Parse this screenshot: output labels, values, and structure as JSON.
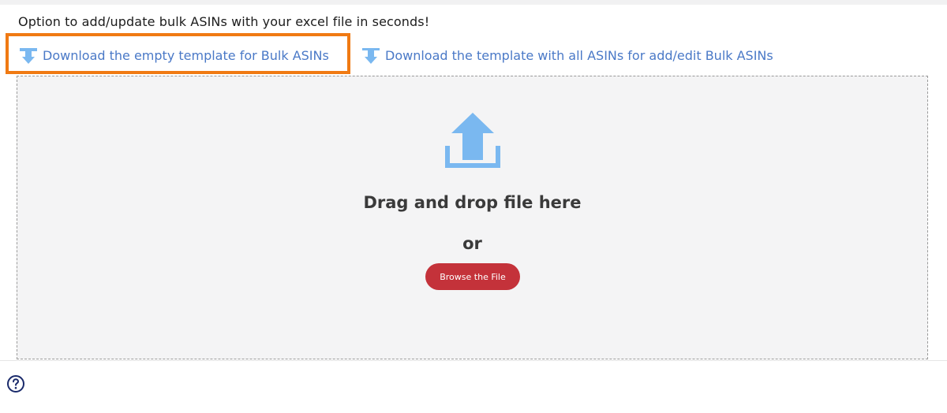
{
  "intro_text": "Option to add/update bulk ASINs with your excel file in seconds!",
  "links": {
    "empty_template": {
      "label": "Download the empty template for Bulk ASINs",
      "icon": "download-icon"
    },
    "all_asins_template": {
      "label": "Download the template with all ASINs for add/edit Bulk ASINs",
      "icon": "download-icon"
    }
  },
  "dropzone": {
    "icon": "upload-icon",
    "drag_text": "Drag and drop file here",
    "or_text": "or",
    "browse_label": "Browse the File"
  },
  "help": {
    "icon": "help-circle-icon"
  },
  "colors": {
    "link": "#4a79c7",
    "icon_blue": "#7ab8f0",
    "highlight": "#f07a13",
    "browse_button": "#c4323a",
    "dropzone_bg": "#f4f4f5",
    "help_icon": "#1a2a6b"
  }
}
